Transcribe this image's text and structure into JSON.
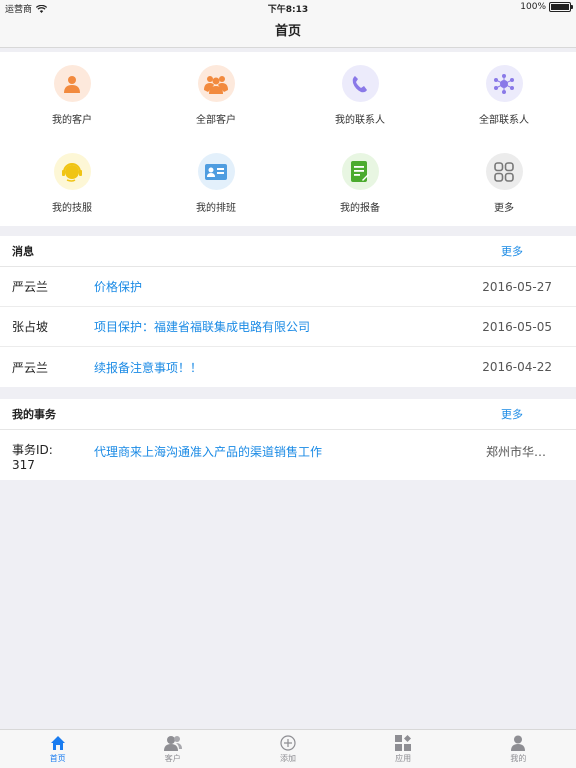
{
  "status_bar": {
    "carrier": "运营商",
    "time": "下午8:13",
    "battery": "100%"
  },
  "nav": {
    "title": "首页"
  },
  "grid": [
    {
      "label": "我的客户",
      "icon": "person-icon",
      "bg": "#fde9dc",
      "color": "#f28a3e"
    },
    {
      "label": "全部客户",
      "icon": "people-icon",
      "bg": "#fde9dc",
      "color": "#f28a3e"
    },
    {
      "label": "我的联系人",
      "icon": "phone-icon",
      "bg": "#ecebfb",
      "color": "#8a79e8"
    },
    {
      "label": "全部联系人",
      "icon": "network-icon",
      "bg": "#ecebfb",
      "color": "#8a79e8"
    },
    {
      "label": "我的技服",
      "icon": "headset-icon",
      "bg": "#fdf7d6",
      "color": "#f0c414"
    },
    {
      "label": "我的排班",
      "icon": "id-card-icon",
      "bg": "#e3f0fb",
      "color": "#4f9de0"
    },
    {
      "label": "我的报备",
      "icon": "document-icon",
      "bg": "#e8f6e2",
      "color": "#4bab2e"
    },
    {
      "label": "更多",
      "icon": "grid-icon",
      "bg": "#ececec",
      "color": "#777777"
    }
  ],
  "messages": {
    "title": "消息",
    "more": "更多",
    "rows": [
      {
        "name": "严云兰",
        "subject": "价格保护",
        "date": "2016-05-27"
      },
      {
        "name": "张占坡",
        "subject": "项目保护：福建省福联集成电路有限公司",
        "date": "2016-05-05"
      },
      {
        "name": "严云兰",
        "subject": "续报备注意事项！！",
        "date": "2016-04-22"
      }
    ]
  },
  "tasks": {
    "title": "我的事务",
    "more": "更多",
    "rows": [
      {
        "id_label": "事务ID:",
        "id_value": "317",
        "subject": "代理商来上海沟通准入产品的渠道销售工作",
        "place": "郑州市华…"
      }
    ]
  },
  "tabs": [
    {
      "label": "首页",
      "icon": "home-icon"
    },
    {
      "label": "客户",
      "icon": "customers-icon"
    },
    {
      "label": "添加",
      "icon": "add-icon"
    },
    {
      "label": "应用",
      "icon": "apps-icon"
    },
    {
      "label": "我的",
      "icon": "profile-icon"
    }
  ],
  "colors": {
    "accent": "#1a8ae5",
    "tab_active": "#1a7cf0",
    "tab_inactive": "#8e8e93"
  }
}
